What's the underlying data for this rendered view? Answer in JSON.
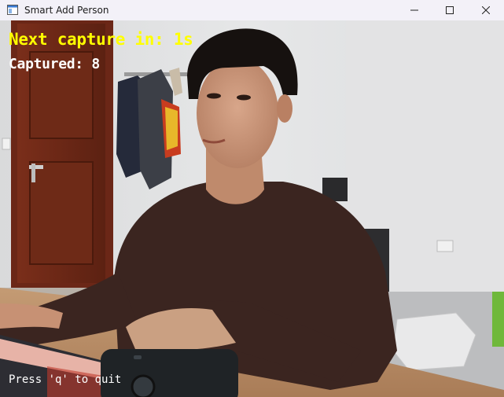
{
  "window": {
    "title": "Smart Add Person",
    "app_icon": "window-app-icon",
    "controls": {
      "minimize_icon": "minimize-icon",
      "maximize_icon": "maximize-icon",
      "close_icon": "close-icon"
    }
  },
  "camera_overlay": {
    "next_capture_text": "Next capture in: 1s",
    "captured_text": "Captured: 8",
    "quit_hint": "Press 'q' to quit",
    "colors": {
      "next_capture": "#ffff00",
      "captured": "#ffffff",
      "quit_hint": "#ffffff"
    }
  }
}
